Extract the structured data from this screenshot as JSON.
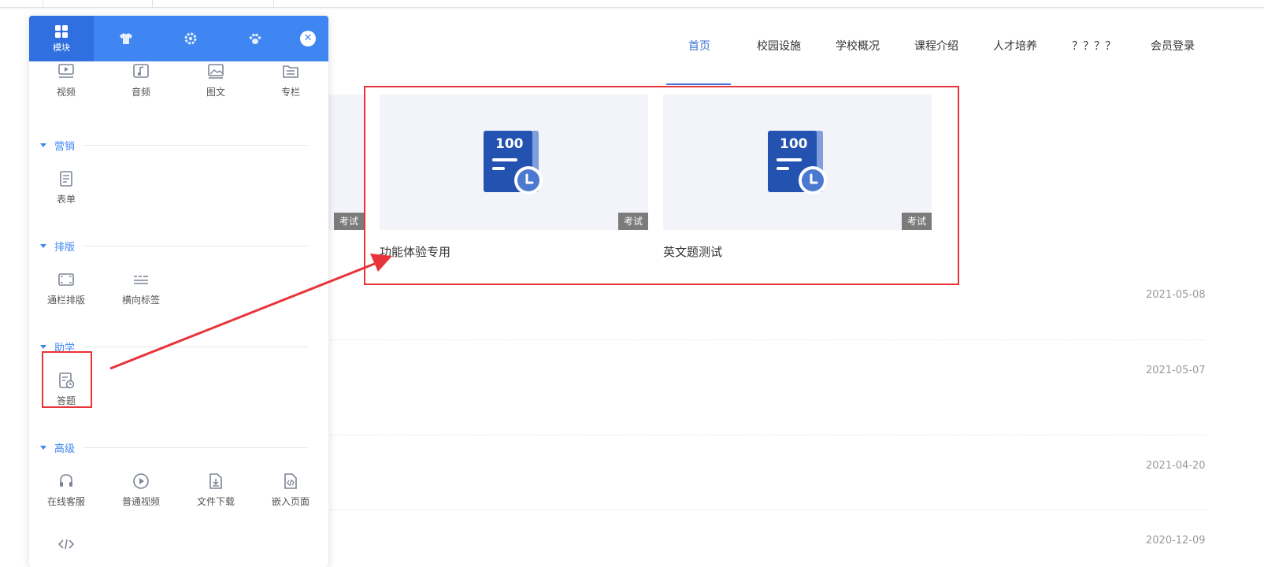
{
  "nav": {
    "items": [
      "首页",
      "校园设施",
      "学校概况",
      "课程介绍",
      "人才培养",
      "？？？？",
      "会员登录"
    ],
    "active_index": 0
  },
  "cards": [
    {
      "badge_number": "100",
      "tag": "考试",
      "title": "功能体验专用"
    },
    {
      "badge_number": "100",
      "tag": "考试",
      "title": "英文题测试"
    }
  ],
  "partial_card": {
    "tag": "考试"
  },
  "list_dates": [
    "2021-05-08",
    "2021-05-07",
    "2021-04-20",
    "2020-12-09"
  ],
  "panel": {
    "tabs": [
      {
        "icon": "grid-icon",
        "label": "模块"
      },
      {
        "icon": "shirt-icon",
        "label": ""
      },
      {
        "icon": "gear-icon",
        "label": ""
      },
      {
        "icon": "paw-icon",
        "label": ""
      }
    ],
    "close_icon": "close-icon",
    "top_modules": [
      {
        "icon": "video-icon",
        "label": "视频"
      },
      {
        "icon": "music-icon",
        "label": "音频"
      },
      {
        "icon": "image-icon",
        "label": "图文"
      },
      {
        "icon": "column-icon",
        "label": "专栏"
      }
    ],
    "sections": [
      {
        "title": "营销",
        "modules": [
          {
            "icon": "form-icon",
            "label": "表单"
          }
        ]
      },
      {
        "title": "排版",
        "modules": [
          {
            "icon": "fullwidth-icon",
            "label": "通栏排版"
          },
          {
            "icon": "tabs-icon",
            "label": "横向标签"
          }
        ]
      },
      {
        "title": "助学",
        "modules": [
          {
            "icon": "quiz-icon",
            "label": "答题"
          }
        ]
      },
      {
        "title": "高级",
        "modules": [
          {
            "icon": "headset-icon",
            "label": "在线客服"
          },
          {
            "icon": "play-circle-icon",
            "label": "普通视频"
          },
          {
            "icon": "file-download-icon",
            "label": "文件下载"
          },
          {
            "icon": "embed-page-icon",
            "label": "嵌入页面"
          },
          {
            "icon": "code-icon",
            "label": ""
          }
        ]
      }
    ]
  },
  "colors": {
    "accent": "#3f86f2",
    "nav_active": "#3d72d6",
    "annotation": "#e8333a",
    "badge_blue": "#2352b0"
  }
}
